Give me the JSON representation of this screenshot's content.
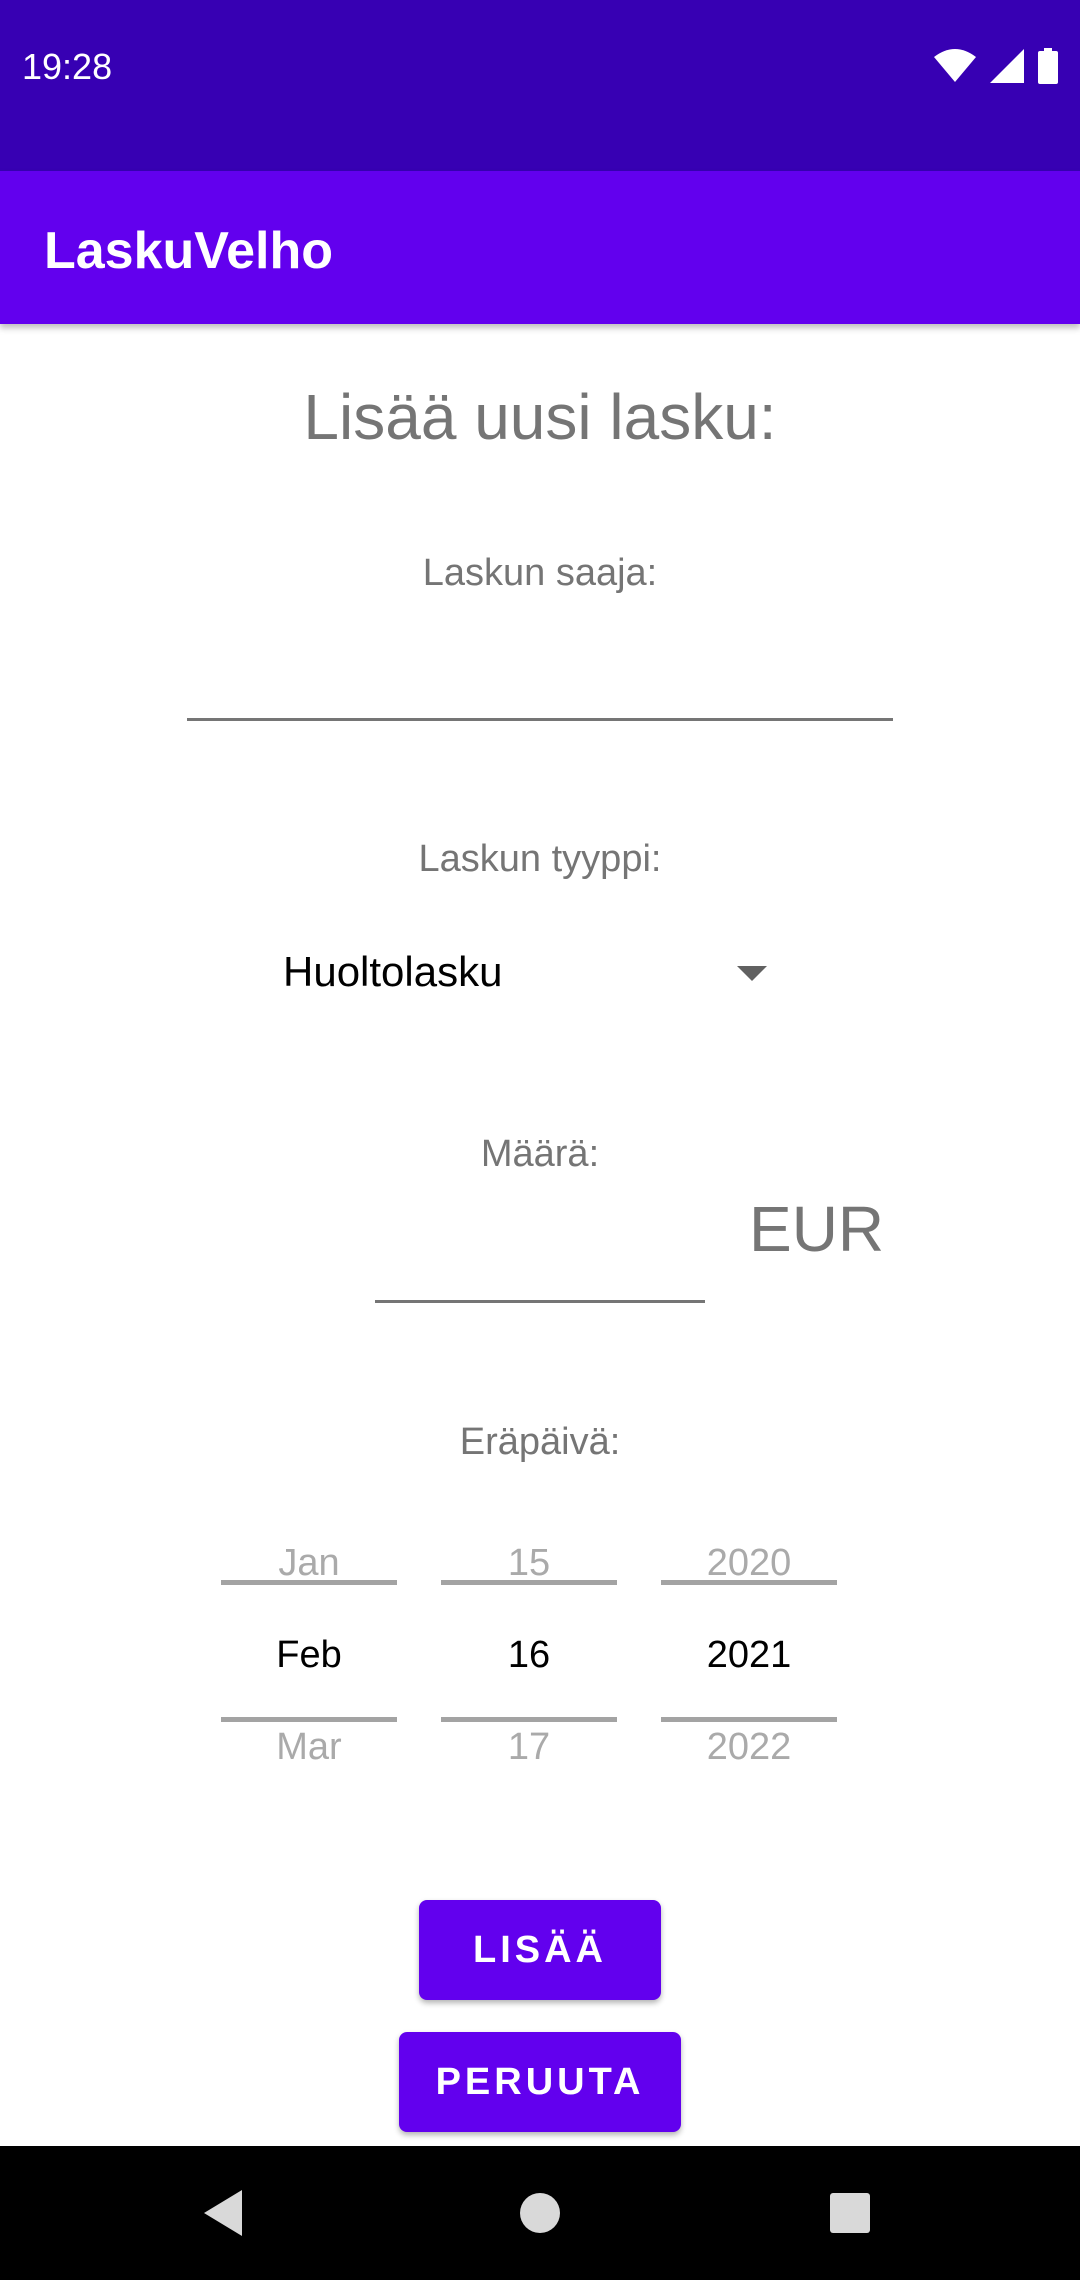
{
  "status_bar": {
    "time": "19:28"
  },
  "app_bar": {
    "title": "LaskuVelho"
  },
  "form": {
    "heading": "Lisää uusi lasku:",
    "recipient": {
      "label": "Laskun saaja:",
      "value": ""
    },
    "type": {
      "label": "Laskun tyyppi:",
      "selected": "Huoltolasku"
    },
    "amount": {
      "label": "Määrä:",
      "value": "",
      "currency": "EUR"
    },
    "due_date": {
      "label": "Eräpäivä:",
      "month": {
        "prev": "Jan",
        "current": "Feb",
        "next": "Mar"
      },
      "day": {
        "prev": "15",
        "current": "16",
        "next": "17"
      },
      "year": {
        "prev": "2020",
        "current": "2021",
        "next": "2022"
      }
    },
    "add_label": "LISÄÄ",
    "cancel_label": "PERUUTA"
  },
  "colors": {
    "status_bar": "#3700b3",
    "app_bar": "#6200ee",
    "button": "#6200ee"
  },
  "icons": {
    "status": [
      "wifi-icon",
      "cellular-signal-icon",
      "battery-icon"
    ],
    "nav": [
      "back-icon",
      "home-icon",
      "recents-icon"
    ]
  }
}
